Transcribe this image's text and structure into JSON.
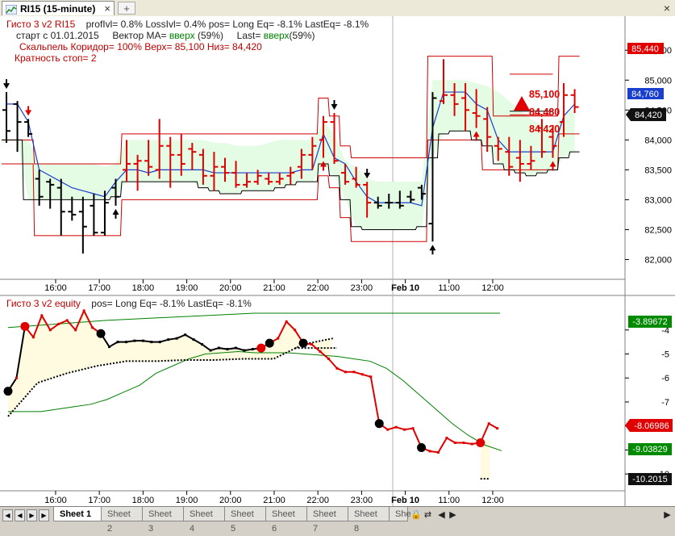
{
  "window": {
    "title": "RI15 (15-minute)",
    "close_glyph": "×",
    "newtab_glyph": "+"
  },
  "info_top": {
    "line1_name": "Гисто 3 v2  RI15",
    "line1_stats": "profIvl= 0.8%   LossIvl= 0.4%   pos= Long   Eq= -8.1%   LastEq= -8.1%",
    "line2_start": "старт с  01.01.2015",
    "line2_vec_label": "Вектор MA=",
    "line2_vec_value": "вверх",
    "line2_vec_pct": "(59%)",
    "line2_last_label": "Last=",
    "line2_last_value": "вверх",
    "line2_last_pct": "(59%)",
    "line3": "Скальпель   Коридор= 100%  Верх= 85,100   Низ= 84,420",
    "line4": "Кратность стоп= 2"
  },
  "info_bottom": {
    "name": "Гисто 3 v2 equity",
    "stats": "pos= Long      Eq= -8.1%     LastEq= -8.1%"
  },
  "annotations": {
    "upper": "85,100",
    "mid": "84,480",
    "lower": "84,420"
  },
  "price_tags": {
    "red": "85,440",
    "blue": "84,760",
    "black": "84,420"
  },
  "equity_tags": {
    "green_top": "-3.89672",
    "red": "-8.06986",
    "green": "-9.03829",
    "black": "-10.2015"
  },
  "colors": {
    "up_bar": "#e00000",
    "down_bar": "#000000",
    "band": "#e3fce3",
    "channel": "#d00000",
    "ma": "#1a3fcf",
    "equity": "#e00000",
    "equity_fill": "#fffbe0",
    "equity_ma": "#008000"
  },
  "chart_data": [
    {
      "type": "ohlc",
      "title": "RI15 (15-minute)",
      "x_tick_labels": [
        "16:00",
        "17:00",
        "18:00",
        "19:00",
        "20:00",
        "21:00",
        "22:00",
        "23:00",
        "Feb 10",
        "11:00",
        "12:00"
      ],
      "x_ticks": [
        4.5,
        8.5,
        12.5,
        16.5,
        20.5,
        24.5,
        28.5,
        32.5,
        36.5,
        40.5,
        44.5
      ],
      "y_ticks": [
        82000,
        82500,
        83000,
        83500,
        84000,
        84500,
        85000,
        85500
      ],
      "y_tick_labels": [
        "82,000",
        "82,500",
        "83,000",
        "83,500",
        "84,000",
        "84,500",
        "85,000",
        "85,500"
      ],
      "ylim": [
        81750,
        85800
      ],
      "bars": [
        {
          "o": 84500,
          "h": 84800,
          "l": 83950,
          "c": 84150,
          "up": false
        },
        {
          "o": 84600,
          "h": 84650,
          "l": 83800,
          "c": 84300,
          "up": false
        },
        {
          "o": 84300,
          "h": 84350,
          "l": 84050,
          "c": 84100,
          "up": false
        },
        {
          "o": 83350,
          "h": 83500,
          "l": 82900,
          "c": 83050,
          "up": false
        },
        {
          "o": 83300,
          "h": 83350,
          "l": 82850,
          "c": 83250,
          "up": false
        },
        {
          "o": 83200,
          "h": 83350,
          "l": 82400,
          "c": 82800,
          "up": false
        },
        {
          "o": 82800,
          "h": 83050,
          "l": 82650,
          "c": 82750,
          "up": false
        },
        {
          "o": 82800,
          "h": 83050,
          "l": 82100,
          "c": 82550,
          "up": false
        },
        {
          "o": 82900,
          "h": 83100,
          "l": 82400,
          "c": 82450,
          "up": false
        },
        {
          "o": 82450,
          "h": 83150,
          "l": 82400,
          "c": 82950,
          "up": false
        },
        {
          "o": 83200,
          "h": 83350,
          "l": 82900,
          "c": 83050,
          "up": false
        },
        {
          "o": 83500,
          "h": 84000,
          "l": 83300,
          "c": 83600,
          "up": true
        },
        {
          "o": 83600,
          "h": 83750,
          "l": 83150,
          "c": 83650,
          "up": true
        },
        {
          "o": 83650,
          "h": 84000,
          "l": 83400,
          "c": 83550,
          "up": true
        },
        {
          "o": 83500,
          "h": 84350,
          "l": 83350,
          "c": 83900,
          "up": true
        },
        {
          "o": 83900,
          "h": 84050,
          "l": 83200,
          "c": 83750,
          "up": true
        },
        {
          "o": 83750,
          "h": 84100,
          "l": 83400,
          "c": 83600,
          "up": true
        },
        {
          "o": 83850,
          "h": 83950,
          "l": 83500,
          "c": 83800,
          "up": true
        },
        {
          "o": 83750,
          "h": 83850,
          "l": 83250,
          "c": 83400,
          "up": true
        },
        {
          "o": 83400,
          "h": 83800,
          "l": 83150,
          "c": 83550,
          "up": true
        },
        {
          "o": 83550,
          "h": 83700,
          "l": 83300,
          "c": 83450,
          "up": true
        },
        {
          "o": 83450,
          "h": 83650,
          "l": 83200,
          "c": 83250,
          "up": true
        },
        {
          "o": 83250,
          "h": 83450,
          "l": 83200,
          "c": 83300,
          "up": true
        },
        {
          "o": 83300,
          "h": 83500,
          "l": 83250,
          "c": 83400,
          "up": true
        },
        {
          "o": 83350,
          "h": 83450,
          "l": 83250,
          "c": 83300,
          "up": true
        },
        {
          "o": 83300,
          "h": 83450,
          "l": 83250,
          "c": 83350,
          "up": true
        },
        {
          "o": 83400,
          "h": 83550,
          "l": 83250,
          "c": 83450,
          "up": true
        },
        {
          "o": 83550,
          "h": 83850,
          "l": 83350,
          "c": 83750,
          "up": true
        },
        {
          "o": 83750,
          "h": 84050,
          "l": 83500,
          "c": 83900,
          "up": true
        },
        {
          "o": 84000,
          "h": 84400,
          "l": 83700,
          "c": 84300,
          "up": true
        },
        {
          "o": 84300,
          "h": 84450,
          "l": 83600,
          "c": 83650,
          "up": true
        },
        {
          "o": 83450,
          "h": 83600,
          "l": 83250,
          "c": 83300,
          "up": true
        },
        {
          "o": 83350,
          "h": 83550,
          "l": 83200,
          "c": 83250,
          "up": true
        },
        {
          "o": 83250,
          "h": 83300,
          "l": 82700,
          "c": 82950,
          "up": true
        },
        {
          "o": 82950,
          "h": 83050,
          "l": 82850,
          "c": 82900,
          "up": false
        },
        {
          "o": 82950,
          "h": 83100,
          "l": 82850,
          "c": 82950,
          "up": false
        },
        {
          "o": 82950,
          "h": 83150,
          "l": 82850,
          "c": 82900,
          "up": false
        },
        {
          "o": 83050,
          "h": 83150,
          "l": 82950,
          "c": 83000,
          "up": false
        },
        {
          "o": 83200,
          "h": 83250,
          "l": 83000,
          "c": 83100,
          "up": false
        },
        {
          "o": 82600,
          "h": 84800,
          "l": 82300,
          "c": 84700,
          "up": false
        },
        {
          "o": 84650,
          "h": 85350,
          "l": 84600,
          "c": 84750,
          "up": true
        },
        {
          "o": 84750,
          "h": 84950,
          "l": 84400,
          "c": 84600,
          "up": true
        },
        {
          "o": 84700,
          "h": 84950,
          "l": 84150,
          "c": 84500,
          "up": true
        },
        {
          "o": 84450,
          "h": 84850,
          "l": 84200,
          "c": 84400,
          "up": true
        },
        {
          "o": 84350,
          "h": 84550,
          "l": 83800,
          "c": 84050,
          "up": true
        },
        {
          "o": 83900,
          "h": 84050,
          "l": 83650,
          "c": 83850,
          "up": true
        },
        {
          "o": 83800,
          "h": 84050,
          "l": 83400,
          "c": 83550,
          "up": true
        },
        {
          "o": 83700,
          "h": 84000,
          "l": 83300,
          "c": 83600,
          "up": true
        },
        {
          "o": 83600,
          "h": 83900,
          "l": 83500,
          "c": 83650,
          "up": true
        },
        {
          "o": 84200,
          "h": 84350,
          "l": 83700,
          "c": 83800,
          "up": true
        },
        {
          "o": 84050,
          "h": 84250,
          "l": 83700,
          "c": 83900,
          "up": true
        },
        {
          "o": 84300,
          "h": 84950,
          "l": 84050,
          "c": 84750,
          "up": true
        },
        {
          "o": 84750,
          "h": 84850,
          "l": 84450,
          "c": 84550,
          "up": true
        }
      ],
      "channel_upper": [
        84000,
        84000,
        84000,
        83600,
        83600,
        83600,
        83600,
        83600,
        83600,
        83600,
        83600,
        84100,
        84100,
        84100,
        84100,
        84100,
        84100,
        84100,
        84100,
        84100,
        84100,
        84100,
        84100,
        84100,
        84100,
        84100,
        84100,
        84100,
        84100,
        84700,
        84400,
        83900,
        83700,
        83700,
        83700,
        83700,
        83700,
        83700,
        83700,
        85400,
        85400,
        85400,
        85400,
        85400,
        85400,
        84400,
        84400,
        84400,
        84400,
        84400,
        84400,
        85400,
        85400
      ],
      "channel_lower": [
        83600,
        83600,
        83600,
        82400,
        82400,
        82400,
        82400,
        82400,
        82400,
        82400,
        82400,
        83000,
        83000,
        83000,
        83000,
        83000,
        83000,
        83000,
        83000,
        83000,
        83000,
        83000,
        83000,
        83000,
        83000,
        83000,
        83000,
        83000,
        83000,
        83400,
        83200,
        82700,
        82300,
        82300,
        82300,
        82300,
        82300,
        82300,
        82300,
        84000,
        84000,
        84000,
        84000,
        84000,
        83500,
        83500,
        83500,
        83500,
        83500,
        83500,
        83500,
        84100,
        84100
      ],
      "ma": [
        84600,
        84600,
        84300,
        83500,
        83400,
        83300,
        83200,
        83150,
        83100,
        83050,
        83300,
        83500,
        83500,
        83450,
        83500,
        83500,
        83500,
        83500,
        83500,
        83450,
        83450,
        83450,
        83450,
        83450,
        83450,
        83450,
        83450,
        83500,
        83500,
        84100,
        83700,
        83600,
        83300,
        83050,
        82950,
        82950,
        82950,
        82950,
        82900,
        84200,
        84800,
        84800,
        84800,
        84600,
        84500,
        84000,
        83800,
        83800,
        83800,
        83800,
        83800,
        84400,
        84600
      ],
      "band_upper": [
        84000,
        84000,
        84000,
        83600,
        83600,
        83600,
        83600,
        83600,
        83600,
        83550,
        83600,
        84000,
        84000,
        84000,
        84000,
        84000,
        84000,
        84000,
        84000,
        83950,
        83950,
        83900,
        83900,
        83900,
        83950,
        84000,
        84000,
        84000,
        84000,
        84300,
        84100,
        83650,
        83550,
        83350,
        83300,
        83300,
        83300,
        83300,
        83300,
        85000,
        85000,
        85000,
        85000,
        84950,
        84900,
        84800,
        84650,
        84500,
        84350,
        84250,
        84200,
        84450,
        84500
      ],
      "band_lower": [
        84000,
        84000,
        83000,
        83000,
        83000,
        83000,
        83000,
        83000,
        83000,
        83000,
        83050,
        83300,
        83300,
        83300,
        83300,
        83300,
        83300,
        83300,
        83200,
        83150,
        83100,
        83100,
        83150,
        83150,
        83150,
        83200,
        83250,
        83300,
        83300,
        83600,
        83400,
        83000,
        82550,
        82500,
        82500,
        82500,
        82500,
        82500,
        82550,
        83700,
        84100,
        84150,
        84150,
        84000,
        83900,
        83600,
        83500,
        83450,
        83400,
        83450,
        83500,
        83700,
        83800
      ],
      "up_arrows": [
        10,
        29,
        39,
        43,
        50
      ],
      "down_arrows": [
        0,
        2,
        30,
        33
      ],
      "horizontal_levels": [
        85100,
        84480,
        84420
      ]
    },
    {
      "type": "line",
      "title": "Гисто 3 v2 equity",
      "y_ticks": [
        -4,
        -5,
        -6,
        -7,
        -8,
        -9,
        -10
      ],
      "y_tick_labels": [
        "-4",
        "-5",
        "-6",
        "-7",
        "-8",
        "-9",
        "-10"
      ],
      "ylim": [
        -10.6,
        -3.2
      ],
      "equity": [
        -6.55,
        -6.0,
        -3.85,
        -4.3,
        -3.4,
        -4.0,
        -3.75,
        -3.6,
        -4.0,
        -3.2,
        -3.9,
        -4.15,
        -4.7,
        -4.5,
        -4.5,
        -4.45,
        -4.45,
        -4.5,
        -4.5,
        -4.4,
        -4.35,
        -4.2,
        -4.4,
        -4.6,
        -4.85,
        -4.75,
        -4.8,
        -4.75,
        -4.85,
        -4.8,
        -4.75,
        -4.55,
        -4.35,
        -3.65,
        -4.0,
        -4.55,
        -4.6,
        -4.9,
        -5.2,
        -5.6,
        -5.75,
        -5.75,
        -5.85,
        -5.95,
        -7.9,
        -8.15,
        -8.05,
        -8.15,
        -8.1,
        -8.9,
        -9.05,
        -9.1,
        -8.5,
        -8.7,
        -8.7,
        -8.75,
        -8.7,
        -7.9,
        -8.1
      ],
      "equity_ma": [
        -7.4,
        -7.4,
        -7.4,
        -7.3,
        -7.2,
        -7.1,
        -6.9,
        -6.6,
        -6.3,
        -5.8,
        -5.5,
        -5.2,
        -5.0,
        -4.95,
        -4.9,
        -4.95,
        -4.95,
        -4.95,
        -5.0,
        -5.05,
        -5.1,
        -5.2,
        -5.3,
        -5.6,
        -6.1,
        -6.7,
        -7.3,
        -7.9,
        -8.4,
        -8.8,
        -9.03
      ],
      "equity_envelope_top": [
        -3.9,
        -3.75,
        -3.6,
        -3.5,
        -3.4,
        -3.3,
        -3.3,
        -3.3,
        -3.3,
        -3.3,
        -3.3
      ],
      "dashed_lower": [
        -7.6,
        -6.2,
        -5.8,
        -5.5,
        -5.3,
        -5.3,
        -5.25,
        -5.25,
        -5.2,
        -5.2,
        -4.6,
        -4.35
      ],
      "dots_black": [
        0,
        11,
        31,
        35,
        44,
        49
      ],
      "dots_red": [
        2,
        30,
        56
      ],
      "x_tick_labels": [
        "16:00",
        "17:00",
        "18:00",
        "19:00",
        "20:00",
        "21:00",
        "22:00",
        "23:00",
        "Feb 10",
        "11:00",
        "12:00"
      ],
      "x_ticks": [
        4.5,
        8.5,
        12.5,
        16.5,
        20.5,
        24.5,
        28.5,
        32.5,
        36.5,
        40.5,
        44.5
      ]
    }
  ],
  "sheets": [
    "Sheet 1",
    "Sheet 2",
    "Sheet 3",
    "Sheet 4",
    "Sheet 5",
    "Sheet 6",
    "Sheet 7",
    "Sheet 8",
    "She"
  ],
  "active_sheet": "Sheet 1"
}
